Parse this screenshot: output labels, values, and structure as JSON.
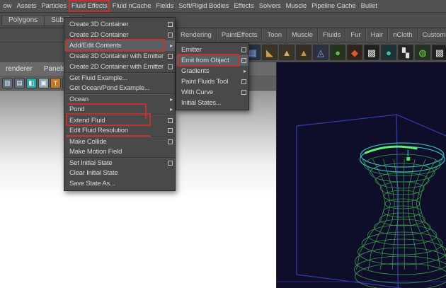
{
  "colors": {
    "accent_red": "#c43131",
    "viewport_bg": "#0e0e2b",
    "wire_blue": "#3b3bb0",
    "wire_green": "#3fa24c",
    "wire_teal": "#2fb9b4",
    "wire_highlight": "#5ef06e",
    "ui_gray": "#4d4d4d"
  },
  "icons": {
    "submenu_arrow": "▸"
  },
  "menubar": {
    "items": [
      {
        "label": "ow"
      },
      {
        "label": "Assets"
      },
      {
        "label": "Particles"
      },
      {
        "label": "Fluid Effects",
        "annotated": true
      },
      {
        "label": "Fluid nCache"
      },
      {
        "label": "Fields"
      },
      {
        "label": "Soft/Rigid Bodies"
      },
      {
        "label": "Effects"
      },
      {
        "label": "Solvers"
      },
      {
        "label": "Muscle"
      },
      {
        "label": "Pipeline Cache"
      },
      {
        "label": "Bullet"
      }
    ]
  },
  "statusrow": {
    "tabs": [
      {
        "label": "Polygons"
      },
      {
        "label": "Subdivs"
      }
    ]
  },
  "shelf": {
    "tabs": [
      {
        "label": "Rendering"
      },
      {
        "label": "PaintEffects"
      },
      {
        "label": "Toon"
      },
      {
        "label": "Muscle"
      },
      {
        "label": "Fluids"
      },
      {
        "label": "Fur"
      },
      {
        "label": "Hair"
      },
      {
        "label": "nCloth"
      },
      {
        "label": "Custom"
      }
    ],
    "icons": [
      {
        "g": "▦",
        "bg": "#232b3d",
        "fg": "#6d8fc9"
      },
      {
        "g": "▢",
        "bg": "#232b3d",
        "fg": "#8fb0e0"
      },
      {
        "g": "▦",
        "bg": "#232b3d",
        "fg": "#6d8fc9"
      },
      {
        "g": "▢",
        "bg": "#283046",
        "fg": "#8fb0e0"
      },
      {
        "g": "▦",
        "bg": "#283046",
        "fg": "#7a9ad0"
      },
      {
        "g": "◣",
        "bg": "#3a3526",
        "fg": "#c99f56"
      },
      {
        "g": "▲",
        "bg": "#3a3526",
        "fg": "#d6ae62"
      },
      {
        "g": "▲",
        "bg": "#342f22",
        "fg": "#bd964d"
      },
      {
        "g": "◬",
        "bg": "#2c3040",
        "fg": "#8aa6d6"
      },
      {
        "g": "●",
        "bg": "#24321f",
        "fg": "#5cbf3f"
      },
      {
        "g": "◆",
        "bg": "#33211c",
        "fg": "#cf5f31"
      },
      {
        "g": "▩",
        "bg": "#1f1f1f",
        "fg": "#d8d8d8"
      },
      {
        "g": "●",
        "bg": "#1d3233",
        "fg": "#3fc1b0"
      },
      {
        "g": "▚",
        "bg": "#242424",
        "fg": "#e0e0e0"
      },
      {
        "g": "◍",
        "bg": "#243321",
        "fg": "#6ed44f"
      },
      {
        "g": "▩",
        "bg": "#202020",
        "fg": "#cfcfcf"
      }
    ]
  },
  "panelbar": {
    "items": [
      {
        "label": "renderer"
      },
      {
        "label": "Panels"
      }
    ]
  },
  "paneltools": {
    "icons": [
      {
        "g": "▥",
        "bg": "#5f6e7c"
      },
      {
        "g": "▤",
        "bg": "#5f6e7c"
      },
      {
        "g": "◧",
        "bg": "#2aa9a9"
      },
      {
        "g": "▣",
        "bg": "#93a2b0"
      },
      {
        "g": "T",
        "bg": "#c07a28"
      },
      {
        "g": "▦",
        "bg": "#57687c"
      },
      {
        "g": "▦",
        "bg": "#57687c"
      },
      {
        "g": "▦",
        "bg": "#57687c"
      }
    ]
  },
  "fluid_menu": {
    "items": [
      {
        "label": "Create 3D Container",
        "box": true
      },
      {
        "label": "Create 2D Container",
        "box": true
      },
      {
        "label": "Add/Edit Contents",
        "submenu": true,
        "hl": true
      },
      {
        "label": "Create 3D Container with Emitter",
        "box": true
      },
      {
        "label": "Create 2D Container with Emitter",
        "box": true
      },
      {
        "label": "Get Fluid Example...",
        "sep": true
      },
      {
        "label": "Get Ocean/Pond Example..."
      },
      {
        "label": "Ocean",
        "submenu": true,
        "sep": true
      },
      {
        "label": "Pond",
        "submenu": true
      },
      {
        "label": "Extend Fluid",
        "box": true,
        "sep": true
      },
      {
        "label": "Edit Fluid Resolution",
        "box": true
      },
      {
        "label": "Make Collide",
        "box": true,
        "sep": true
      },
      {
        "label": "Make Motion Field"
      },
      {
        "label": "Set Initial State",
        "box": true,
        "sep": true
      },
      {
        "label": "Clear Initial State"
      },
      {
        "label": "Save State As..."
      }
    ]
  },
  "contents_submenu": {
    "items": [
      {
        "label": "Emitter",
        "box": true
      },
      {
        "label": "Emit from Object",
        "box": true,
        "hl": true
      },
      {
        "label": "Gradients",
        "submenu": true
      },
      {
        "label": "Paint Fluids Tool",
        "box": true
      },
      {
        "label": "With Curve",
        "box": true
      },
      {
        "label": "Initial States..."
      }
    ]
  }
}
